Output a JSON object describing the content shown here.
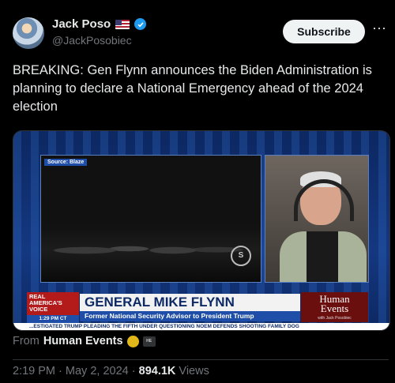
{
  "author": {
    "name": "Jack Poso",
    "flag_icon": "us-flag-icon",
    "handle": "@JackPosobiec",
    "verified_color": "#1d9bf0"
  },
  "actions": {
    "subscribe_label": "Subscribe",
    "more_label": "···"
  },
  "tweet": {
    "text": "BREAKING: Gen Flynn announces the Biden Administration is planning to declare a National Emergency ahead of the 2024 election"
  },
  "media": {
    "source_label": "Source: Blaze",
    "watermark": "S",
    "network_logo": "REAL AMERICA'S VOICE",
    "time_bug": "1:29 PM CT",
    "guest_name": "GENERAL MIKE FLYNN",
    "guest_title": "Former National Security Advisor to President Trump",
    "show_logo_line1": "Human",
    "show_logo_line2": "Events",
    "show_logo_sub": "with Jack Posobiec",
    "ticker": "...ESTIGATED TRUMP PLEADING THE FIFTH UNDER QUESTIONING    NOEM DEFENDS SHOOTING FAMILY DOG"
  },
  "attribution": {
    "from_label": "From",
    "source_name": "Human Events",
    "badge_label": "HE"
  },
  "meta": {
    "time": "2:19 PM",
    "separator": "·",
    "date": "May 2, 2024",
    "views_count": "894.1K",
    "views_label": "Views"
  }
}
